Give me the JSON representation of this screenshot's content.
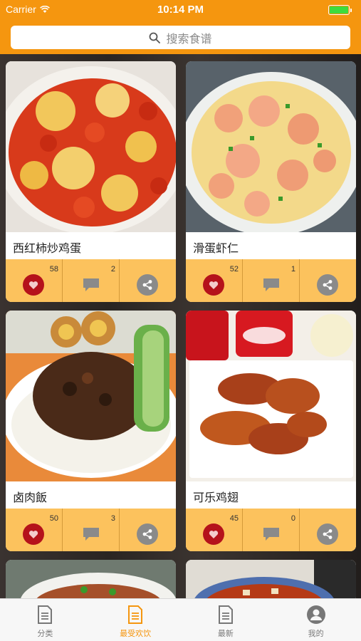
{
  "status": {
    "carrier": "Carrier",
    "time": "10:14 PM"
  },
  "search": {
    "placeholder": "搜索食谱"
  },
  "recipes": [
    {
      "title": "西红柿炒鸡蛋",
      "likes": "58",
      "comments": "2"
    },
    {
      "title": "滑蛋虾仁",
      "likes": "52",
      "comments": "1"
    },
    {
      "title": "卤肉飯",
      "likes": "50",
      "comments": "3"
    },
    {
      "title": "可乐鸡翅",
      "likes": "45",
      "comments": "0"
    }
  ],
  "tabs": [
    {
      "label": "分类",
      "icon": "document-icon"
    },
    {
      "label": "最受欢饮",
      "icon": "document-icon",
      "active": true
    },
    {
      "label": "最新",
      "icon": "document-icon"
    },
    {
      "label": "我的",
      "icon": "user-icon"
    }
  ],
  "colors": {
    "accent": "#f5960f",
    "action_bar": "#fcc25d",
    "like": "#b5121b"
  }
}
